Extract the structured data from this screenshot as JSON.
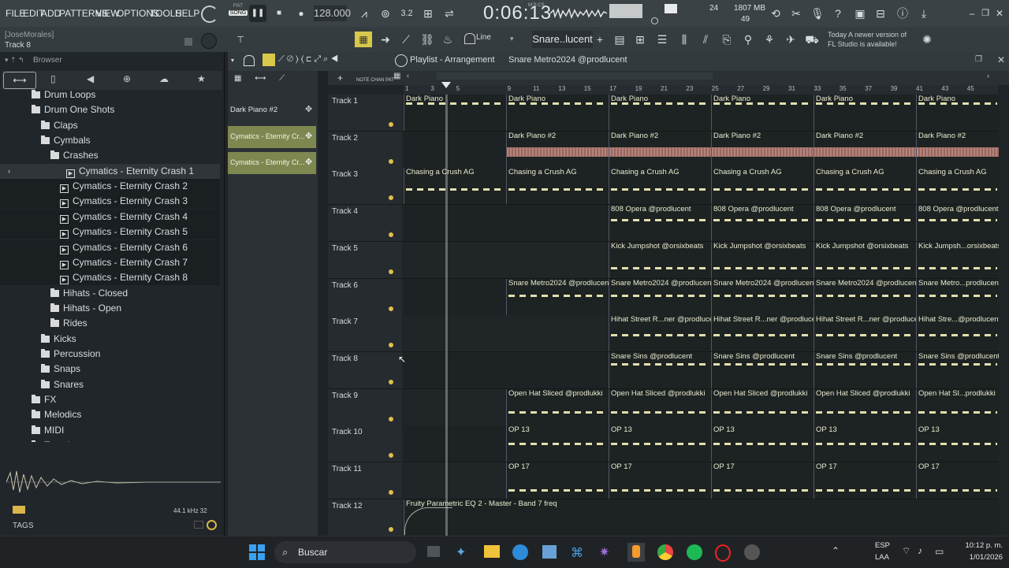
{
  "menu": [
    "FILE",
    "EDIT",
    "ADD",
    "PATTERNS",
    "VIEW",
    "OPTIONS",
    "TOOLS",
    "HELP"
  ],
  "transport": {
    "pat_label": "PAT",
    "song_label": "SONG",
    "tempo": "128.000",
    "time": "0:06:13",
    "time_unit": "M:S:CS",
    "cpu_value": "24",
    "mem": "1807 MB",
    "mem_sub": "49"
  },
  "hint": {
    "user": "[JoseMorales]",
    "track": "Track 8"
  },
  "toolbar2": {
    "snap": "Line",
    "pattern": "Snare..lucent",
    "news_line1": "Today  A newer version of",
    "news_line2": "FL Studio is available!"
  },
  "browser": {
    "title": "Browser",
    "items": [
      {
        "label": "Drum Loops",
        "type": "folder",
        "indent": 40
      },
      {
        "label": "Drum One Shots",
        "type": "folder",
        "indent": 40
      },
      {
        "label": "Claps",
        "type": "folder",
        "indent": 52
      },
      {
        "label": "Cymbals",
        "type": "folder",
        "indent": 52
      },
      {
        "label": "Crashes",
        "type": "folder",
        "indent": 64
      },
      {
        "label": "Cymatics - Eternity Crash 1",
        "type": "file",
        "indent": 84,
        "selected": true
      },
      {
        "label": "Cymatics - Eternity Crash 2",
        "type": "file",
        "indent": 76
      },
      {
        "label": "Cymatics - Eternity Crash 3",
        "type": "file",
        "indent": 76
      },
      {
        "label": "Cymatics - Eternity Crash 4",
        "type": "file",
        "indent": 76
      },
      {
        "label": "Cymatics - Eternity Crash 5",
        "type": "file",
        "indent": 76
      },
      {
        "label": "Cymatics - Eternity Crash 6",
        "type": "file",
        "indent": 76
      },
      {
        "label": "Cymatics - Eternity Crash 7",
        "type": "file",
        "indent": 76
      },
      {
        "label": "Cymatics - Eternity Crash 8",
        "type": "file",
        "indent": 76
      },
      {
        "label": "Hihats - Closed",
        "type": "folder",
        "indent": 64
      },
      {
        "label": "Hihats - Open",
        "type": "folder",
        "indent": 64
      },
      {
        "label": "Rides",
        "type": "folder",
        "indent": 64
      },
      {
        "label": "Kicks",
        "type": "folder",
        "indent": 52
      },
      {
        "label": "Percussion",
        "type": "folder",
        "indent": 52
      },
      {
        "label": "Snaps",
        "type": "folder",
        "indent": 52
      },
      {
        "label": "Snares",
        "type": "folder",
        "indent": 52
      },
      {
        "label": "FX",
        "type": "folder",
        "indent": 40
      },
      {
        "label": "Melodics",
        "type": "folder",
        "indent": 40
      },
      {
        "label": "MIDI",
        "type": "folder",
        "indent": 40
      },
      {
        "label": "Tape Loops",
        "type": "folder",
        "indent": 40
      }
    ],
    "sample_rate": "44.1 kHz 32",
    "tags": "TAGS"
  },
  "playlist": {
    "title": "Playlist - Arrangement",
    "pattern": "Snare Metro2024 @prodlucent",
    "patterns": [
      "Dark Piano #2",
      "Cymatics - Eternity Cr...",
      "Cymatics - Eternity Cr..."
    ],
    "ruler": [
      "1",
      "3",
      "5",
      "9",
      "11",
      "13",
      "15",
      "17",
      "19",
      "21",
      "23",
      "25",
      "27",
      "29",
      "31",
      "33",
      "35",
      "37",
      "39",
      "41",
      "43",
      "45"
    ],
    "tracks": [
      {
        "name": "Track 1",
        "clips": [
          "Dark Piano",
          "Dark Piano",
          "Dark Piano",
          "Dark Piano",
          "Dark Piano",
          "Dark Piano"
        ]
      },
      {
        "name": "Track 2",
        "clips": [
          "Dark Piano #2",
          "Dark Piano #2",
          "Dark Piano #2",
          "Dark Piano #2",
          "Dark Piano #2"
        ]
      },
      {
        "name": "Track 3",
        "clips": [
          "Chasing a Crush AG",
          "Chasing a Crush AG",
          "Chasing a Crush AG",
          "Chasing a Crush AG",
          "Chasing a Crush AG",
          "Chasing a Crush AG"
        ]
      },
      {
        "name": "Track 4",
        "clips": [
          "808 Opera @prodlucent",
          "808 Opera @prodlucent",
          "808 Opera @prodlucent",
          "808 Opera @prodlucent"
        ]
      },
      {
        "name": "Track 5",
        "clips": [
          "Kick Jumpshot @orsixbeats",
          "Kick Jumpshot @orsixbeats",
          "Kick Jumpshot @orsixbeats",
          "Kick Jumpsh...orsixbeats"
        ]
      },
      {
        "name": "Track 6",
        "clips": [
          "Snare Metro2024 @prodlucent",
          "Snare Metro2024 @prodlucent",
          "Snare Metro2024 @prodlucent",
          "Snare Metro2024 @prodlucent",
          "Snare Metro...prodlucent"
        ]
      },
      {
        "name": "Track 7",
        "clips": [
          "Hihat Street R...ner @prodlucent",
          "Hihat Street R...ner @prodlucent",
          "Hihat Street R...ner @prodlucent",
          "Hihat Stre...@prodlucent"
        ]
      },
      {
        "name": "Track 8",
        "clips": [
          "Snare Sins @prodlucent",
          "Snare Sins @prodlucent",
          "Snare Sins @prodlucent",
          "Snare Sins @prodlucent"
        ]
      },
      {
        "name": "Track 9",
        "clips": [
          "Open Hat Sliced @prodlukki",
          "Open Hat Sliced @prodlukki",
          "Open Hat Sliced @prodlukki",
          "Open Hat Sliced @prodlukki",
          "Open Hat Sl...prodlukki"
        ]
      },
      {
        "name": "Track 10",
        "clips": [
          "OP 13",
          "OP 13",
          "OP 13",
          "OP 13",
          "OP 13"
        ]
      },
      {
        "name": "Track 11",
        "clips": [
          "OP 17",
          "OP 17",
          "OP 17",
          "OP 17",
          "OP 17"
        ]
      },
      {
        "name": "Track 12",
        "clips": [
          "Fruity Parametric EQ 2 - Master - Band 7 freq"
        ]
      }
    ]
  },
  "taskbar": {
    "search": "Buscar",
    "lang1": "ESP",
    "lang2": "LAA",
    "time": "10:12 p. m.",
    "date": "1/01/2026"
  }
}
